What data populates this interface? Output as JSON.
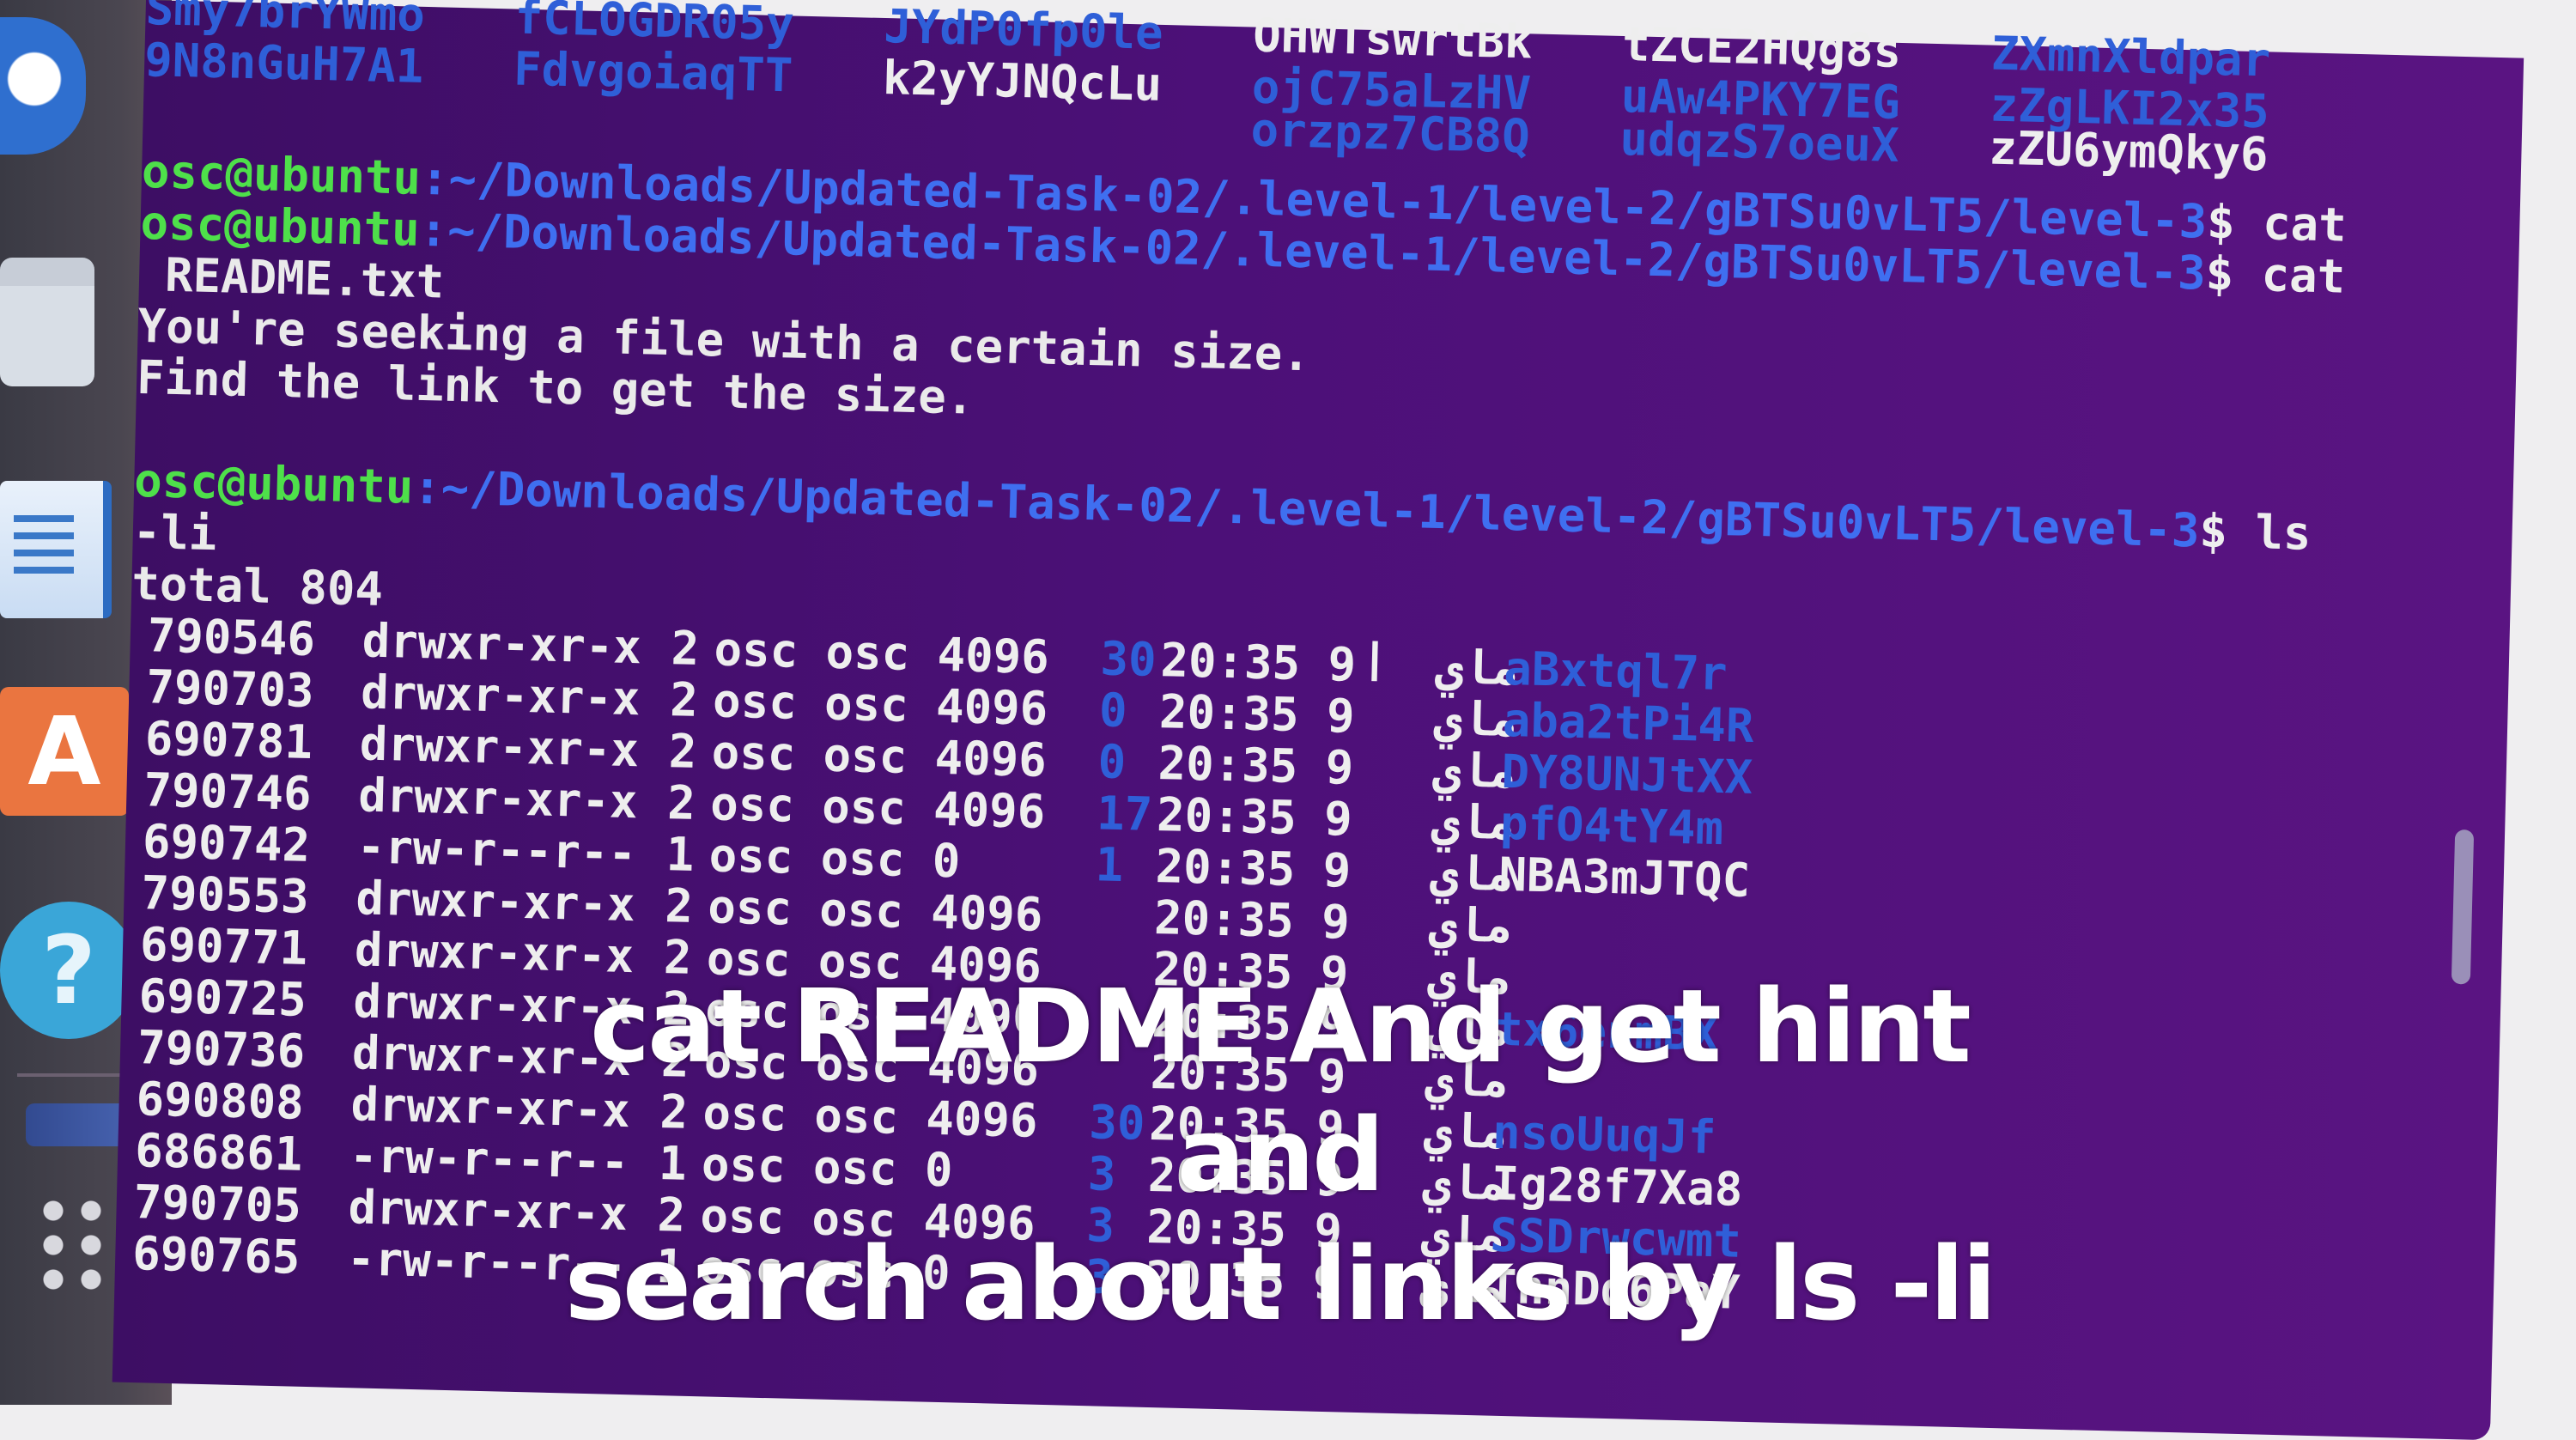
{
  "terminal": {
    "ls_rows": [
      [
        "Smy7brYWmo",
        "fCLOGDR05y",
        "JYdP0fp0le",
        "OHWTswrtBk",
        "tZCE2HQg8s",
        "ZXmnXldpar"
      ],
      [
        "9N8nGuH7A1",
        "FdvgoiaqTT",
        "k2yYJNQcLu",
        "ojC75aLzHV",
        "uAw4PKY7EG",
        "zZgLKI2x35"
      ],
      [
        "",
        "",
        "",
        "orzpz7CB8Q",
        "udqzS7oeuX",
        "zZU6ymQky6"
      ]
    ],
    "prompt_user": "osc@ubuntu",
    "prompt_path": ":~/Downloads/Updated-Task-02/.level-1/level-2/gBTSu0vLT5/level-3",
    "cmd_cat": "$ cat",
    "cat_arg": "README.txt",
    "readme_line1": "You're seeking a file with a certain size.",
    "readme_line2": "Find the link to get the size.",
    "cmd_ls": "$ ls",
    "ls_arg": "-li",
    "total": "total 804",
    "listing": [
      {
        "inode": "790546",
        "perm": "drwxr-xr-x",
        "links": "2",
        "owner": "osc",
        "group": "osc",
        "size": "4096",
        "day": "30",
        "time": "20:35 9",
        "month": "ماي",
        "name": "aBxtql7r"
      },
      {
        "inode": "790703",
        "perm": "drwxr-xr-x",
        "links": "2",
        "owner": "osc",
        "group": "osc",
        "size": "4096",
        "day": "0",
        "time": "20:35 9",
        "month": "ماي",
        "name": "aba2tPi4R"
      },
      {
        "inode": "690781",
        "perm": "drwxr-xr-x",
        "links": "2",
        "owner": "osc",
        "group": "osc",
        "size": "4096",
        "day": "0",
        "time": "20:35 9",
        "month": "ماي",
        "name": "DY8UNJtXX"
      },
      {
        "inode": "790746",
        "perm": "drwxr-xr-x",
        "links": "2",
        "owner": "osc",
        "group": "osc",
        "size": "4096",
        "day": "17",
        "time": "20:35 9",
        "month": "ماي",
        "name": "pfO4tY4m"
      },
      {
        "inode": "690742",
        "perm": "-rw-r--r--",
        "links": "1",
        "owner": "osc",
        "group": "osc",
        "size": "0",
        "day": "1",
        "time": "20:35 9",
        "month": "ماي",
        "name": "NBA3mJTQC"
      },
      {
        "inode": "790553",
        "perm": "drwxr-xr-x",
        "links": "2",
        "owner": "osc",
        "group": "osc",
        "size": "4096",
        "day": "",
        "time": "20:35 9",
        "month": "ماي",
        "name": ""
      },
      {
        "inode": "690771",
        "perm": "drwxr-xr-x",
        "links": "2",
        "owner": "osc",
        "group": "osc",
        "size": "4096",
        "day": "",
        "time": "20:35 9",
        "month": "ماي",
        "name": ""
      },
      {
        "inode": "690725",
        "perm": "drwxr-xr-x",
        "links": "2",
        "owner": "osc",
        "group": "osc",
        "size": "4096",
        "day": "",
        "time": "20:35 9",
        "month": "ماي",
        "name": "tx6enmBX"
      },
      {
        "inode": "790736",
        "perm": "drwxr-xr-x",
        "links": "2",
        "owner": "osc",
        "group": "osc",
        "size": "4096",
        "day": "",
        "time": "20:35 9",
        "month": "ماي",
        "name": ""
      },
      {
        "inode": "690808",
        "perm": "drwxr-xr-x",
        "links": "2",
        "owner": "osc",
        "group": "osc",
        "size": "4096",
        "day": "30",
        "time": "20:35 9",
        "month": "ماي",
        "name": "nsoUuqJf"
      },
      {
        "inode": "686861",
        "perm": "-rw-r--r--",
        "links": "1",
        "owner": "osc",
        "group": "osc",
        "size": "0",
        "day": "3",
        "time": "20:35 9",
        "month": "ماي",
        "name": "Ig28f7Xa8"
      },
      {
        "inode": "790705",
        "perm": "drwxr-xr-x",
        "links": "2",
        "owner": "osc",
        "group": "osc",
        "size": "4096",
        "day": "3",
        "time": "20:35 9",
        "month": "ماي",
        "name": "SSDrwcwmt"
      },
      {
        "inode": "690765",
        "perm": "-rw-r--r--",
        "links": "1",
        "owner": "osc",
        "group": "osc",
        "size": "0",
        "day": "3",
        "time": "20:35 9",
        "month": "ماي",
        "name": "TnnDd6PaY"
      }
    ]
  },
  "caption": {
    "line1": "cat README And get hint and",
    "line2": "search about links by ls -li"
  },
  "dock": {
    "store_glyph": "A",
    "help_glyph": "?"
  },
  "colors": {
    "terminal_bg": "#4c1078",
    "prompt_user": "#4ee04a",
    "prompt_path": "#3f6ff0",
    "text": "#eaeaea"
  }
}
